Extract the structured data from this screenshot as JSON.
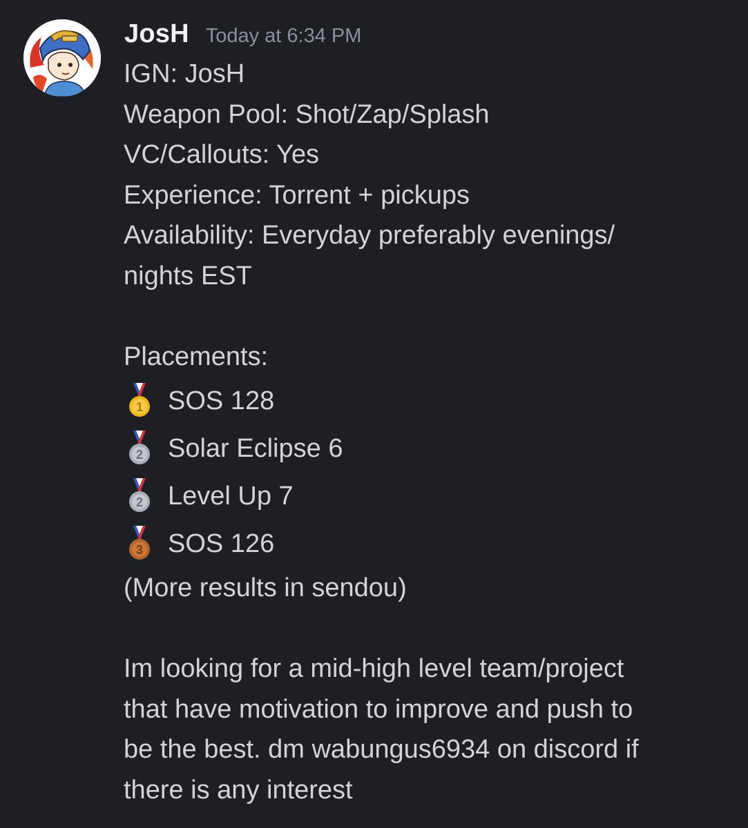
{
  "author": {
    "name": "JosH",
    "timestamp": "Today at 6:34 PM",
    "avatar_icon": "knight-helmet-avatar"
  },
  "message": {
    "lines": [
      "IGN: JosH",
      "Weapon Pool: Shot/Zap/Splash",
      "VC/Callouts: Yes",
      "Experience: Torrent + pickups",
      "Availability: Everyday preferably evenings/",
      "nights EST"
    ],
    "placements_header": "Placements:",
    "placements": [
      {
        "medal": "gold-medal-icon",
        "text": "SOS 128"
      },
      {
        "medal": "silver-medal-icon",
        "text": "Solar Eclipse 6"
      },
      {
        "medal": "silver-medal-icon",
        "text": "Level Up 7"
      },
      {
        "medal": "bronze-medal-icon",
        "text": "SOS 126"
      }
    ],
    "more_results": "(More results in sendou)",
    "closing_lines": [
      "Im looking for a mid-high level team/project",
      "that have motivation to improve and push to",
      "be the best. dm wabungus6934 on discord if",
      "there is any interest"
    ]
  },
  "colors": {
    "background": "#1e1f24",
    "username": "#f1f2f4",
    "timestamp": "#8d9098",
    "text": "#d2d4d8",
    "gold": "#f2b51e",
    "silver": "#a9aeb5",
    "bronze": "#b5652b"
  }
}
